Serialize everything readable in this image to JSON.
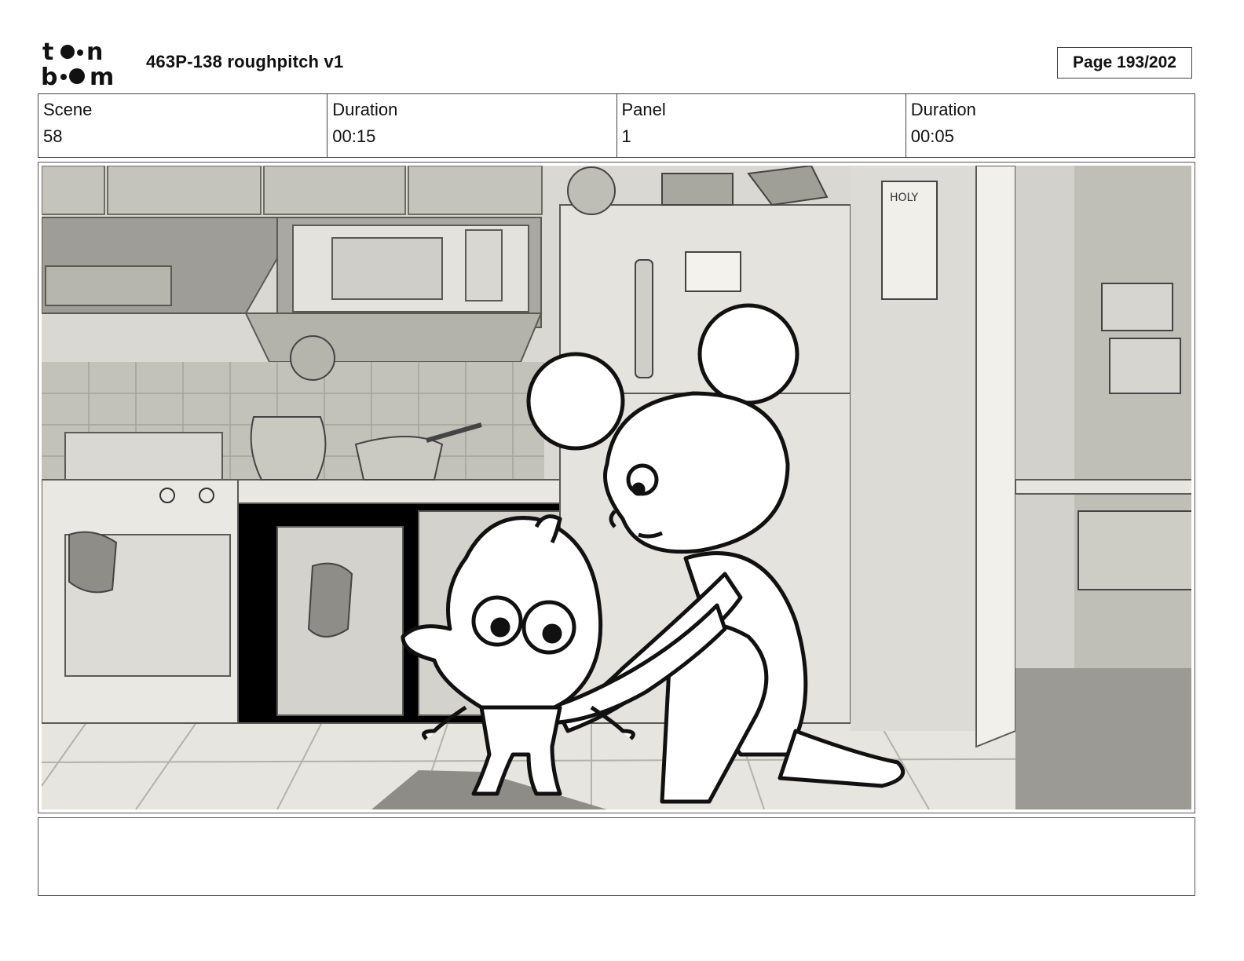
{
  "header": {
    "logo_alt": "toon boom",
    "title": "463P-138 roughpitch v1",
    "page_indicator": "Page 193/202"
  },
  "info": {
    "scene_label": "Scene",
    "scene_value": "58",
    "scene_duration_label": "Duration",
    "scene_duration_value": "00:15",
    "panel_label": "Panel",
    "panel_value": "1",
    "panel_duration_label": "Duration",
    "panel_duration_value": "00:05"
  },
  "panel": {
    "poster_text": "HOLY",
    "colors": {
      "background_wall": "#d9d8d2",
      "cabinet": "#bdbcb5",
      "floor": "#e6e5df",
      "line": "#111111"
    }
  },
  "notes": {
    "text": ""
  }
}
